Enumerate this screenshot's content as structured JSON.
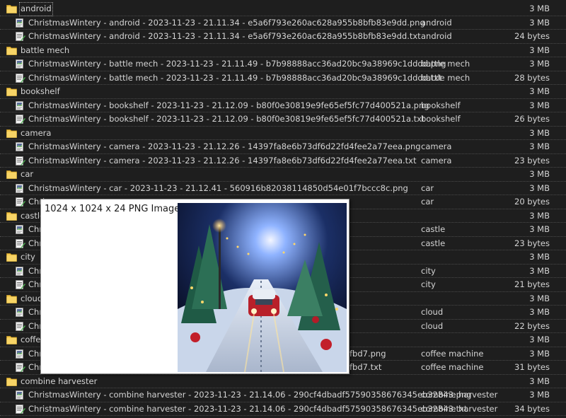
{
  "colors": {
    "background": "#1e1e1e",
    "text": "#d4d4d4",
    "folder": "#f2c64b",
    "preview_bg": "#ffffff"
  },
  "icons": {
    "folder": "folder-icon",
    "png": "image-file-icon",
    "txt": "text-file-icon"
  },
  "rows": [
    {
      "kind": "folder",
      "name": "android",
      "tag": "",
      "size": "3 MB",
      "selected": true
    },
    {
      "kind": "png",
      "name": "ChristmasWintery - android - 2023-11-23 - 21.11.34 - e5a6f793e260ac628a955b8bfb83e9dd.png",
      "tag": "android",
      "size": "3 MB"
    },
    {
      "kind": "txt",
      "name": "ChristmasWintery - android - 2023-11-23 - 21.11.34 - e5a6f793e260ac628a955b8bfb83e9dd.txt",
      "tag": "android",
      "size": "24 bytes"
    },
    {
      "kind": "folder",
      "name": "battle mech",
      "tag": "",
      "size": "3 MB"
    },
    {
      "kind": "png",
      "name": "ChristmasWintery - battle mech - 2023-11-23 - 21.11.49 - b7b98888acc36ad20bc9a38969c1dddd.png",
      "tag": "battle mech",
      "size": "3 MB"
    },
    {
      "kind": "txt",
      "name": "ChristmasWintery - battle mech - 2023-11-23 - 21.11.49 - b7b98888acc36ad20bc9a38969c1dddd.txt",
      "tag": "battle mech",
      "size": "28 bytes"
    },
    {
      "kind": "folder",
      "name": "bookshelf",
      "tag": "",
      "size": "3 MB"
    },
    {
      "kind": "png",
      "name": "ChristmasWintery - bookshelf - 2023-11-23 - 21.12.09 - b80f0e30819e9fe65ef5fc77d400521a.png",
      "tag": "bookshelf",
      "size": "3 MB"
    },
    {
      "kind": "txt",
      "name": "ChristmasWintery - bookshelf - 2023-11-23 - 21.12.09 - b80f0e30819e9fe65ef5fc77d400521a.txt",
      "tag": "bookshelf",
      "size": "26 bytes"
    },
    {
      "kind": "folder",
      "name": "camera",
      "tag": "",
      "size": "3 MB"
    },
    {
      "kind": "png",
      "name": "ChristmasWintery - camera - 2023-11-23 - 21.12.26 - 14397fa8e6b73df6d22fd4fee2a77eea.png",
      "tag": "camera",
      "size": "3 MB"
    },
    {
      "kind": "txt",
      "name": "ChristmasWintery - camera - 2023-11-23 - 21.12.26 - 14397fa8e6b73df6d22fd4fee2a77eea.txt",
      "tag": "camera",
      "size": "23 bytes"
    },
    {
      "kind": "folder",
      "name": "car",
      "tag": "",
      "size": "3 MB"
    },
    {
      "kind": "png",
      "name": "ChristmasWintery - car - 2023-11-23 - 21.12.41 - 560916b82038114850d54e01f7bccc8c.png",
      "tag": "car",
      "size": "3 MB"
    },
    {
      "kind": "txt",
      "name": "Chri",
      "tag": "car",
      "size": "20 bytes"
    },
    {
      "kind": "folder",
      "name": "castle",
      "tag": "",
      "size": "3 MB"
    },
    {
      "kind": "png",
      "name": "Chri",
      "tag": "castle",
      "size": "3 MB"
    },
    {
      "kind": "txt",
      "name": "Chri",
      "tag": "castle",
      "size": "23 bytes"
    },
    {
      "kind": "folder",
      "name": "city",
      "tag": "",
      "size": "3 MB"
    },
    {
      "kind": "png",
      "name": "Chri",
      "tag": "city",
      "size": "3 MB"
    },
    {
      "kind": "txt",
      "name": "Chri",
      "tag": "city",
      "size": "21 bytes"
    },
    {
      "kind": "folder",
      "name": "cloud",
      "tag": "",
      "size": "3 MB"
    },
    {
      "kind": "png",
      "name": "Chri",
      "tag": "cloud",
      "size": "3 MB"
    },
    {
      "kind": "txt",
      "name": "Chri",
      "tag": "cloud",
      "size": "22 bytes"
    },
    {
      "kind": "folder",
      "name": "coffe",
      "tag": "",
      "size": "3 MB"
    },
    {
      "kind": "png",
      "name": "Chri",
      "tail": "fbd7.png",
      "tag": "coffee machine",
      "size": "3 MB"
    },
    {
      "kind": "txt",
      "name": "Chri",
      "tail": "fbd7.txt",
      "tag": "coffee machine",
      "size": "31 bytes"
    },
    {
      "kind": "folder",
      "name": "combine harvester",
      "tag": "",
      "size": "3 MB"
    },
    {
      "kind": "png",
      "name": "ChristmasWintery - combine harvester - 2023-11-23 - 21.14.06 - 290cf4dbadf57590358676345eb32843.png",
      "tag": "combine harvester",
      "size": "3 MB"
    },
    {
      "kind": "txt",
      "name": "ChristmasWintery - combine harvester - 2023-11-23 - 21.14.06 - 290cf4dbadf57590358676345eb32843.txt",
      "tag": "combine harvester",
      "size": "34 bytes"
    }
  ],
  "preview": {
    "caption": "1024 x 1024 x 24 PNG Image"
  }
}
